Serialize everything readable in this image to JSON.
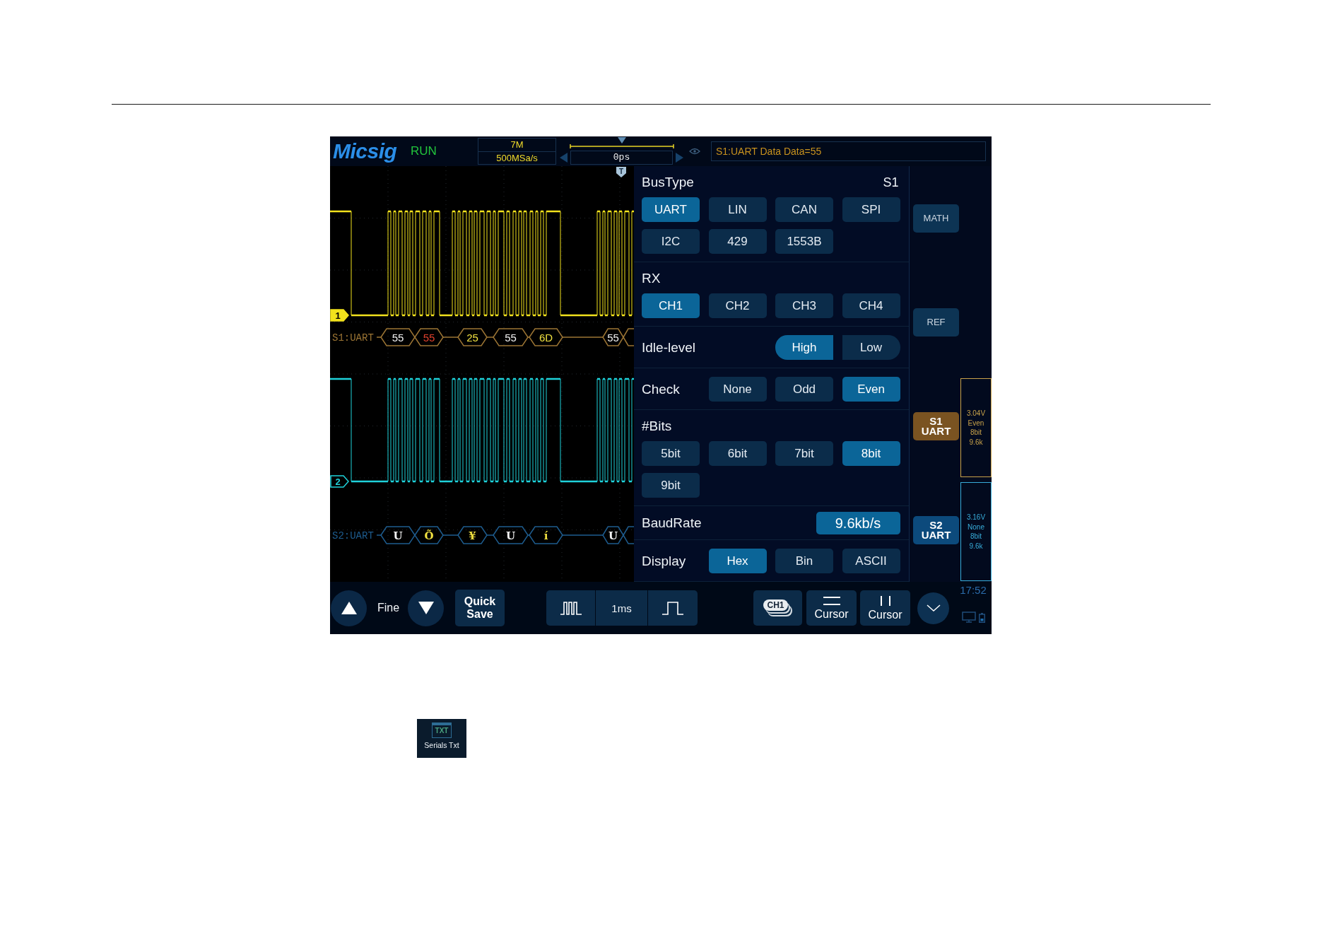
{
  "top_bar": {
    "logo": "Micsig",
    "run_state": "RUN",
    "memory_depth": "7M",
    "sample_rate": "500MSa/s",
    "trigger_offset": "0ps",
    "message": "S1:UART Data Data=55"
  },
  "waveform": {
    "trigger_marker": "T",
    "channels": [
      {
        "marker": "1",
        "color": "#f2e21c",
        "selected": true
      },
      {
        "marker": "2",
        "color": "#1fd2da",
        "selected": false
      }
    ],
    "buses": [
      {
        "label": "S1:UART",
        "color": "#9c7534",
        "frames": [
          {
            "text": "55",
            "color": "#f2f2f2"
          },
          {
            "text": "55",
            "color": "#e0402c"
          },
          {
            "text": "25",
            "color": "#f0e040"
          },
          {
            "text": "55",
            "color": "#f2f2f2"
          },
          {
            "text": "6D",
            "color": "#f0e040"
          },
          {
            "text": "55",
            "color": "#f2f2f2"
          }
        ]
      },
      {
        "label": "S2:UART",
        "color": "#1e5c8e",
        "frames": [
          {
            "text": "U",
            "color": "#f2f2f2"
          },
          {
            "text": "Õ",
            "color": "#f0e040"
          },
          {
            "text": "¥",
            "color": "#f0e040"
          },
          {
            "text": "U",
            "color": "#f2f2f2"
          },
          {
            "text": "í",
            "color": "#f0e040"
          },
          {
            "text": "U",
            "color": "#f2f2f2"
          }
        ]
      }
    ]
  },
  "settings_panel": {
    "sections": [
      {
        "kind": "grid",
        "title": "BusType",
        "tag": "S1",
        "options": [
          {
            "label": "UART",
            "selected": true
          },
          {
            "label": "LIN",
            "selected": false
          },
          {
            "label": "CAN",
            "selected": false
          },
          {
            "label": "SPI",
            "selected": false
          },
          {
            "label": "I2C",
            "selected": false
          },
          {
            "label": "429",
            "selected": false
          },
          {
            "label": "1553B",
            "selected": false
          }
        ]
      },
      {
        "kind": "grid",
        "title": "RX",
        "options": [
          {
            "label": "CH1",
            "selected": true
          },
          {
            "label": "CH2",
            "selected": false
          },
          {
            "label": "CH3",
            "selected": false
          },
          {
            "label": "CH4",
            "selected": false
          }
        ]
      },
      {
        "kind": "segmented",
        "title": "Idle-level",
        "options": [
          {
            "label": "High",
            "selected": true
          },
          {
            "label": "Low",
            "selected": false
          }
        ]
      },
      {
        "kind": "inline",
        "title": "Check",
        "options": [
          {
            "label": "None",
            "selected": false
          },
          {
            "label": "Odd",
            "selected": false
          },
          {
            "label": "Even",
            "selected": true
          }
        ]
      },
      {
        "kind": "grid",
        "title": "#Bits",
        "options": [
          {
            "label": "5bit",
            "selected": false
          },
          {
            "label": "6bit",
            "selected": false
          },
          {
            "label": "7bit",
            "selected": false
          },
          {
            "label": "8bit",
            "selected": true
          },
          {
            "label": "9bit",
            "selected": false
          }
        ]
      },
      {
        "kind": "value",
        "title": "BaudRate",
        "value": "9.6kb/s"
      },
      {
        "kind": "inline",
        "title": "Display",
        "options": [
          {
            "label": "Hex",
            "selected": true
          },
          {
            "label": "Bin",
            "selected": false
          },
          {
            "label": "ASCII",
            "selected": false
          }
        ]
      }
    ]
  },
  "side_buttons": [
    {
      "label": "MATH",
      "on": false,
      "selected": false
    },
    {
      "label": "REF",
      "on": false,
      "selected": false
    },
    {
      "label": "S1 UART",
      "on": true,
      "selected": true,
      "status": {
        "color": "#c9a24a",
        "lines": [
          "3.04V",
          "Even",
          "8bit",
          "9.6k"
        ]
      }
    },
    {
      "label": "S2 UART",
      "on": true,
      "selected": false,
      "status": {
        "color": "#38acd9",
        "lines": [
          "3.16V",
          "None",
          "8bit",
          "9.6k"
        ]
      }
    }
  ],
  "bottom_bar": {
    "fine_label": "Fine",
    "quick_save": "Quick Save",
    "timebase": "1ms",
    "channel_button": "CH1",
    "cursors": [
      {
        "kind": "horizontal",
        "label": "Cursor"
      },
      {
        "kind": "vertical",
        "label": "Cursor"
      }
    ],
    "clock": "17:52"
  },
  "app_shortcut": {
    "icon_text": "TXT",
    "label": "Serials Txt"
  }
}
